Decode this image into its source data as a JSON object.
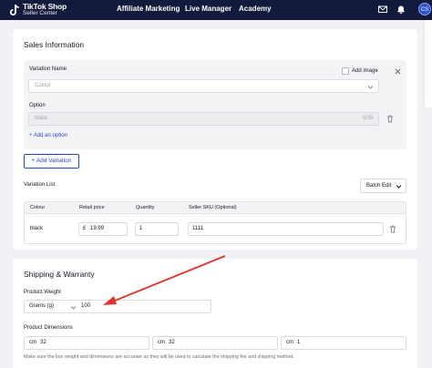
{
  "nav": {
    "logo_line1": "TikTok Shop",
    "logo_line2": "Seller Center",
    "items": [
      "Affiliate Marketing",
      "Live Manager",
      "Academy"
    ],
    "avatar_initials": "CS"
  },
  "sales": {
    "title": "Sales Information",
    "variation_name_label": "Variation Name",
    "add_image_label": "Add image",
    "variation_name_placeholder": "Colour",
    "option_label": "Option",
    "option_value": "black",
    "option_counter": "5/35",
    "add_option_link": "+ Add an option",
    "add_variation_button": "+ Add Variation",
    "variation_list_label": "Variation List",
    "batch_edit_button": "Batch Edit",
    "table": {
      "headers": [
        "Colour",
        "Retail price",
        "Quantity",
        "Seller SKU (Optional)"
      ],
      "rows": [
        {
          "colour": "black",
          "currency": "£",
          "price": "19.99",
          "quantity": "1",
          "sku": "1111"
        }
      ]
    }
  },
  "shipping": {
    "title": "Shipping & Warranty",
    "weight_label": "Product Weight",
    "weight_unit": "Grams (g)",
    "weight_value": "100",
    "dimensions_label": "Product Dimensions",
    "dimensions": [
      {
        "unit": "cm",
        "value": "32"
      },
      {
        "unit": "cm",
        "value": "32"
      },
      {
        "unit": "cm",
        "value": "1"
      }
    ],
    "hint": "Make sure the box weight and dimensions are accurate as they will be used to calculate the shipping fee and shipping method."
  },
  "colors": {
    "nav_bg": "#121b3c",
    "accent": "#2549c4",
    "annotation_arrow": "#e0342c"
  }
}
